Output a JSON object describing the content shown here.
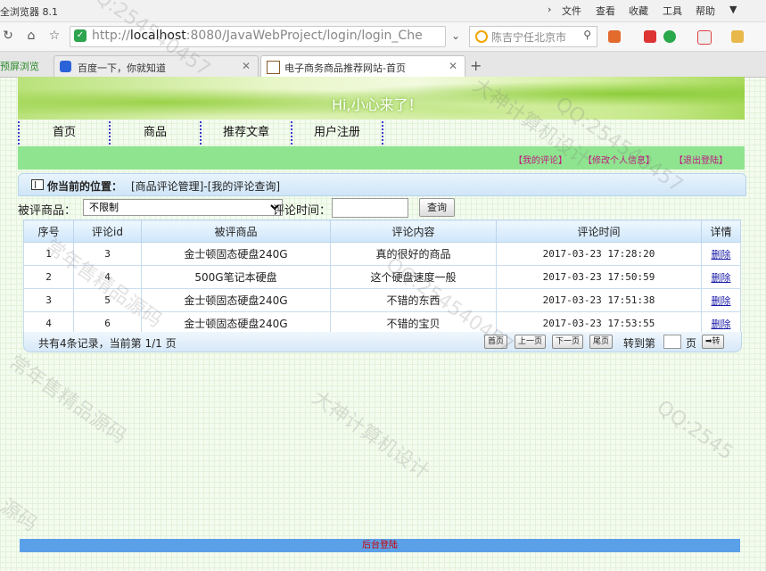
{
  "browser": {
    "app_title": "全浏览器 8.1",
    "menu": [
      "文件",
      "查看",
      "收藏",
      "工具",
      "帮助"
    ],
    "address_prefix": "http://",
    "address_host": "localhost",
    "address_rest": ":8080/JavaWebProject/login/login_Che",
    "search_text": "陈吉宁任北京市",
    "preview_label": "预屏浏览",
    "tabs": [
      {
        "label": "百度一下，你就知道",
        "active": false
      },
      {
        "label": "电子商务商品推荐网站-首页",
        "active": true
      }
    ],
    "new_tab": "+"
  },
  "banner": {
    "greeting": "Hi,小心来了！"
  },
  "nav": {
    "items": [
      "首页",
      "商品",
      "推荐文章",
      "用户注册"
    ]
  },
  "userbar": {
    "links": [
      "【我的评论】",
      "【修改个人信息】",
      "【退出登陆】"
    ]
  },
  "location": {
    "label": "你当前的位置：",
    "path": "[商品评论管理]-[我的评论查询]"
  },
  "filter": {
    "product_label": "被评商品：",
    "product_value": "不限制",
    "time_label": "评论时间：",
    "time_value": "",
    "query_label": "查询"
  },
  "table": {
    "headers": [
      "序号",
      "评论id",
      "被评商品",
      "评论内容",
      "评论时间",
      "详情"
    ],
    "rows": [
      {
        "no": "1",
        "id": "3",
        "product": "金士顿固态硬盘240G",
        "content": "真的很好的商品",
        "time": "2017-03-23 17:28:20",
        "action": "删除"
      },
      {
        "no": "2",
        "id": "4",
        "product": "500G笔记本硬盘",
        "content": "这个硬盘速度一般",
        "time": "2017-03-23 17:50:59",
        "action": "删除"
      },
      {
        "no": "3",
        "id": "5",
        "product": "金士顿固态硬盘240G",
        "content": "不错的东西",
        "time": "2017-03-23 17:51:38",
        "action": "删除"
      },
      {
        "no": "4",
        "id": "6",
        "product": "金士顿固态硬盘240G",
        "content": "不错的宝贝",
        "time": "2017-03-23 17:53:55",
        "action": "删除"
      }
    ]
  },
  "pager": {
    "info": "共有4条记录，当前第 1/1 页",
    "first": "首页",
    "prev": "上一页",
    "next": "下一页",
    "last": "尾页",
    "goto_label": "转到第",
    "page_suffix": "页",
    "go": "➡转"
  },
  "footer": {
    "label": "后台登陆"
  },
  "watermarks": [
    "QQ:254540457",
    "常年售精品源码",
    "大神计算机设计",
    "QQ:254540457",
    "常年售精品源码",
    "大神计算机设计",
    "QQ:254540457",
    "源码",
    "QQ:2545"
  ]
}
